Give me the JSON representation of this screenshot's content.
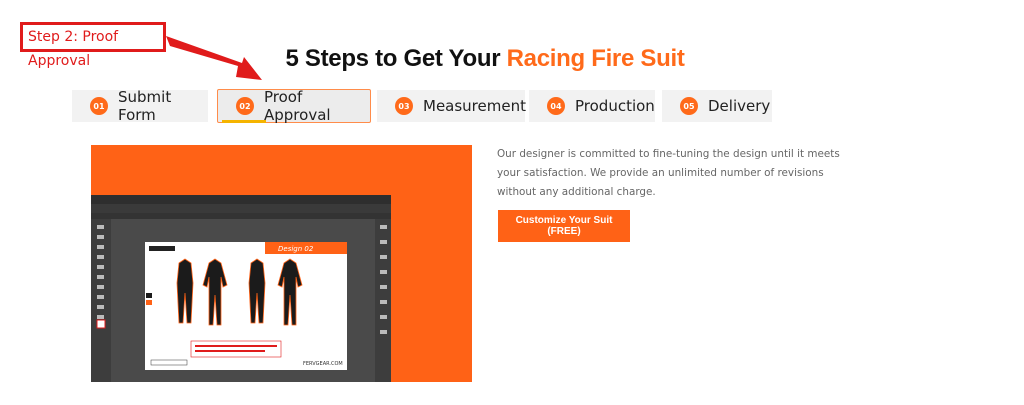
{
  "callout": {
    "label": "Step 2: Proof Approval"
  },
  "heading": {
    "prefix": "5 Steps to Get Your ",
    "accent": "Racing Fire Suit"
  },
  "tabs": [
    {
      "num": "01",
      "label": "Submit Form"
    },
    {
      "num": "02",
      "label": "Proof Approval",
      "active": true
    },
    {
      "num": "03",
      "label": "Measurement"
    },
    {
      "num": "04",
      "label": "Production"
    },
    {
      "num": "05",
      "label": "Delivery"
    }
  ],
  "proof_image": {
    "design_label": "Design 02",
    "brand": "FERVGEAR.COM"
  },
  "description": "Our designer is committed to fine-tuning the design until it meets your satisfaction. We provide an unlimited number of revisions without any additional charge.",
  "cta_label": "Customize Your Suit (FREE)",
  "colors": {
    "accent": "#ff6216",
    "callout": "#e01b1b",
    "tab_bg": "#f2f2f2",
    "active_border": "#ff8c4a",
    "active_indicator": "#f5b400"
  }
}
